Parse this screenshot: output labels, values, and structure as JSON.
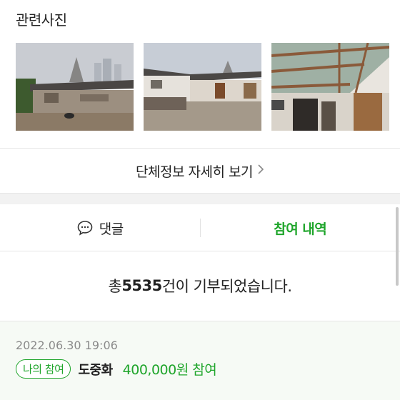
{
  "photos": {
    "title": "관련사진",
    "items": [
      {
        "alt": "house-exterior-photo"
      },
      {
        "alt": "courtyard-photo"
      },
      {
        "alt": "porch-roof-photo"
      }
    ]
  },
  "more_link": {
    "label": "단체정보 자세히 보기",
    "icon": "chevron-right-icon"
  },
  "tabs": {
    "comment_label": "댓글",
    "comment_icon": "speech-bubble-icon",
    "history_label": "참여 내역"
  },
  "summary": {
    "prefix": "총 ",
    "count": "5535",
    "suffix": "건이 기부되었습니다."
  },
  "entry": {
    "date": "2022.06.30 19:06",
    "badge": "나의 참여",
    "donor": "도중화",
    "amount": "400,000원 참여"
  },
  "colors": {
    "accent": "#1fa52b",
    "band": "#f2f2f2",
    "entry_bg": "#f6faf5"
  }
}
